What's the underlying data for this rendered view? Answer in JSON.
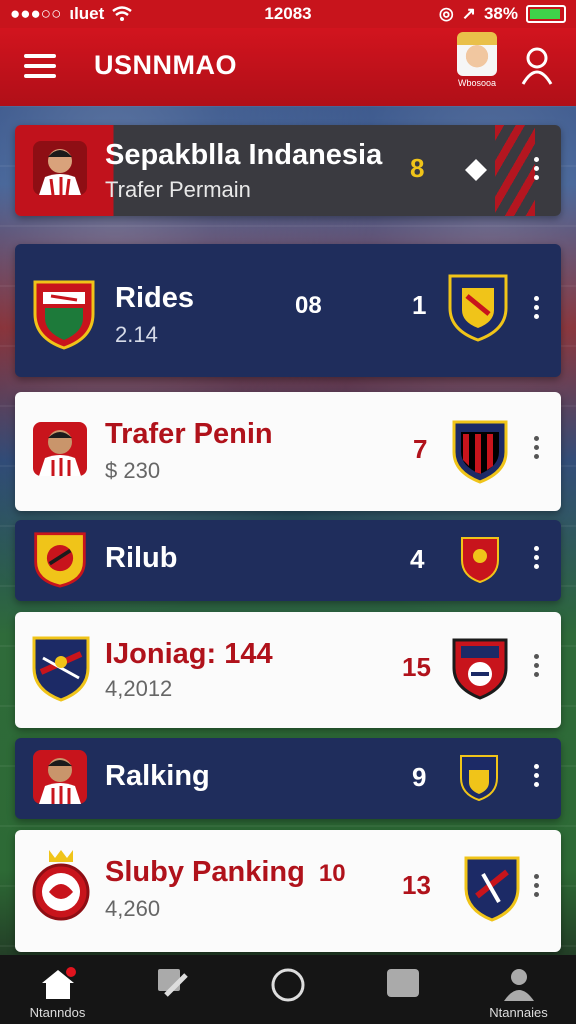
{
  "status_bar": {
    "carrier": "ιluet",
    "time": "12083",
    "battery": "38%"
  },
  "header": {
    "title": "USNNMAO",
    "profile_caption": "Wbosooa"
  },
  "cards": [
    {
      "style": "hero",
      "title": "Sepakblla Indanesia",
      "subtitle": "Trafer Permain",
      "count": "8"
    },
    {
      "style": "dark",
      "title": "Rides",
      "subtitle": "2.14",
      "middle": "08",
      "count": "1"
    },
    {
      "style": "white",
      "title": "Trafer Penin",
      "subtitle": "$ 230",
      "count": "7"
    },
    {
      "style": "dark",
      "title": "Rilub",
      "count": "4"
    },
    {
      "style": "white",
      "title": "IJoniag: 144",
      "subtitle": "4,2012",
      "count": "15"
    },
    {
      "style": "dark",
      "title": "Ralking",
      "count": "9"
    },
    {
      "style": "white",
      "title": "Sluby Panking",
      "title_suffix": "10",
      "subtitle": "4,260",
      "count": "13"
    }
  ],
  "bottom_nav": {
    "home_label": "Ntanndos",
    "profile_label": "Ntannaies"
  },
  "colors": {
    "brand_red": "#c8141c",
    "navy": "#1f2d5c",
    "accent_yellow": "#f0c419"
  }
}
